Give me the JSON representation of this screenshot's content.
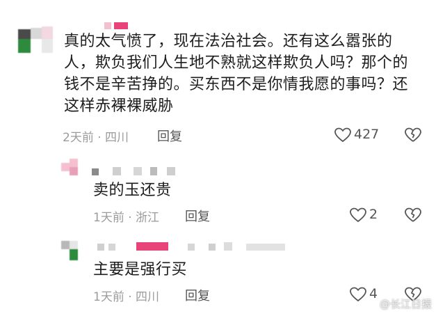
{
  "comments": [
    {
      "text": "真的太气愤了，现在法治社会。还有这么嚣张的人，欺负我们人生地不熟就这样欺负人吗？那个的钱不是辛苦挣的。买东西不是你情我愿的事吗？还这样赤裸裸威胁",
      "lines": [
        "真的太气愤了，现在法治社会。还有这么嚣张的",
        "人，欺负我们人生地不熟就这样欺负人吗？那个的",
        "钱不是辛苦挣的。买东西不是你情我愿的事吗？还",
        "这样赤裸裸威胁"
      ],
      "meta": "2天前 · 四川",
      "reply_label": "回复",
      "likes": "427"
    },
    {
      "text": "卖的玉还贵",
      "meta": "1天前 · 浙江",
      "reply_label": "回复",
      "likes": "2"
    },
    {
      "text": "主要是强行买",
      "meta": "1天前 · 四川",
      "reply_label": "回复",
      "likes": "4"
    }
  ],
  "watermark": {
    "text": "@长江日报"
  },
  "colors": {
    "blur_pink": "#f0a8c0",
    "blur_green": "#2e8b3e",
    "blur_gray": "#c9c9c9",
    "hot_pink": "#e8447a"
  }
}
